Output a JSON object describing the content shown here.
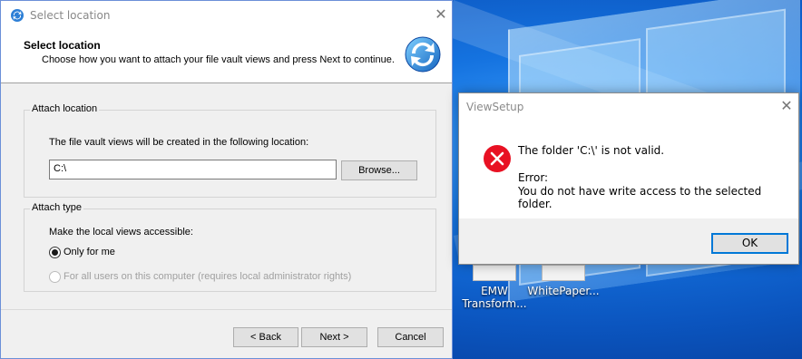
{
  "wizard": {
    "title": "Select location",
    "header_title": "Select location",
    "header_subtitle": "Choose how you want to attach your file vault views and press Next to continue.",
    "attach_location": {
      "legend": "Attach location",
      "description": "The file vault views will be created in the following location:",
      "path_value": "C:\\",
      "browse_label": "Browse..."
    },
    "attach_type": {
      "legend": "Attach type",
      "description": "Make the local views accessible:",
      "options": [
        {
          "label": "Only for me",
          "checked": true,
          "disabled": false
        },
        {
          "label": "For all users on this computer (requires local administrator rights)",
          "checked": false,
          "disabled": true
        }
      ]
    },
    "buttons": {
      "back": "< Back",
      "next": "Next >",
      "cancel": "Cancel"
    }
  },
  "error_dialog": {
    "title": "ViewSetup",
    "message_line1": "The folder 'C:\\' is not valid.",
    "message_line2": "Error:",
    "message_line3": "You do not have write access to the selected folder.",
    "ok_label": "OK",
    "icon": "error-icon"
  },
  "desktop": {
    "icons": [
      {
        "label_line1": "EMW",
        "label_line2": "Transform..."
      },
      {
        "label_line1": "WhitePaper...",
        "label_line2": ""
      }
    ]
  },
  "colors": {
    "accent": "#0078d7",
    "error_red": "#e81123",
    "desktop_blue": "#1573e0"
  }
}
